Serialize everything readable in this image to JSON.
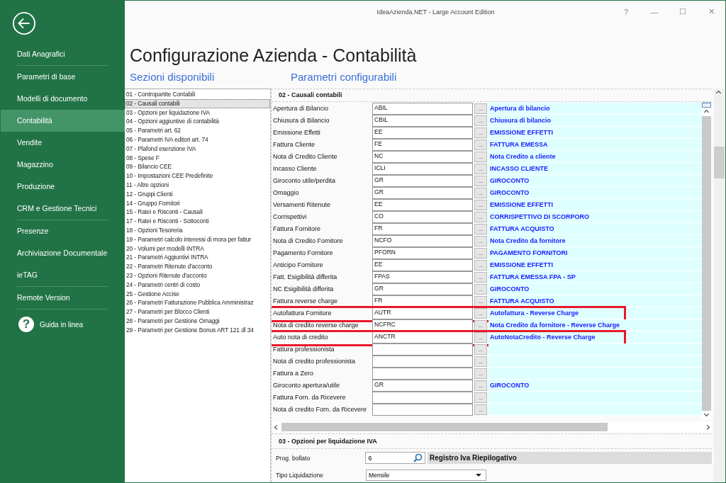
{
  "window": {
    "title": "IdeaAzienda.NET - Large Account Edition",
    "controls": [
      "?",
      "—",
      "☐",
      "✕"
    ]
  },
  "sidebar": {
    "items": [
      {
        "label": "Dati Anagrafici",
        "selected": false,
        "separator": true
      },
      {
        "label": "Parametri di base",
        "selected": false,
        "separator": false
      },
      {
        "label": "Modelli di documento",
        "selected": false,
        "separator": false
      },
      {
        "label": "Contabilità",
        "selected": true,
        "separator": false
      },
      {
        "label": "Vendite",
        "selected": false,
        "separator": false
      },
      {
        "label": "Magazzino",
        "selected": false,
        "separator": false
      },
      {
        "label": "Produzione",
        "selected": false,
        "separator": false
      },
      {
        "label": "CRM e Gestione Tecnici",
        "selected": false,
        "separator": true
      },
      {
        "label": "Presenze",
        "selected": false,
        "separator": false
      },
      {
        "label": "Archiviazione Documentale",
        "selected": false,
        "separator": false
      },
      {
        "label": "ieTAG",
        "selected": false,
        "separator": true
      },
      {
        "label": "Remote Version",
        "selected": false,
        "separator": true
      }
    ],
    "help": {
      "icon": "?",
      "label": "Guida in linea"
    }
  },
  "page": {
    "title": "Configurazione Azienda - Contabilità",
    "sections_heading": "Sezioni disponibili",
    "params_heading": "Parametri configurabili"
  },
  "sections": [
    {
      "label": "01 - Contropartite Contabili",
      "selected": false
    },
    {
      "label": "02 - Causali contabili",
      "selected": true
    },
    {
      "label": "03 - Opzioni per liquidazione IVA",
      "selected": false
    },
    {
      "label": "04 - Opzioni aggiuntive di contabilità",
      "selected": false
    },
    {
      "label": "05 - Parametri art. 62",
      "selected": false
    },
    {
      "label": "06 - Parametri IVA editori art. 74",
      "selected": false
    },
    {
      "label": "07 - Plafond esenzione IVA",
      "selected": false
    },
    {
      "label": "08 - Spese F",
      "selected": false
    },
    {
      "label": "09 - Bilancio CEE",
      "selected": false
    },
    {
      "label": "10 - Impostazioni CEE Predefinite",
      "selected": false
    },
    {
      "label": "11 - Altre opzioni",
      "selected": false
    },
    {
      "label": "12 - Gruppi Clienti",
      "selected": false
    },
    {
      "label": "14 - Gruppo Fornitori",
      "selected": false
    },
    {
      "label": "15 - Ratei e Risconti - Causali",
      "selected": false
    },
    {
      "label": "17 - Ratei e Risconti - Sottoconti",
      "selected": false
    },
    {
      "label": "18 - Opzioni Tesoreria",
      "selected": false
    },
    {
      "label": "19 - Parametri calcolo interessi di mora per fattur",
      "selected": false
    },
    {
      "label": "20 - Volumi per modelli INTRA",
      "selected": false
    },
    {
      "label": "21 - Parametri Aggiuntivi INTRA",
      "selected": false
    },
    {
      "label": "22 - Parametri Ritenute d'acconto",
      "selected": false
    },
    {
      "label": "23 - Opzioni Ritenute d'acconto",
      "selected": false
    },
    {
      "label": "24 - Parametri centri di costo",
      "selected": false
    },
    {
      "label": "25 - Gestione Accise",
      "selected": false
    },
    {
      "label": "26 - Parametri Fatturazione Pubblica Amministraz",
      "selected": false
    },
    {
      "label": "27 - Parametri per Blocco Clienti",
      "selected": false
    },
    {
      "label": "28 - Parametri per Gestione Omaggi",
      "selected": false
    },
    {
      "label": "29 - Parametri per Gestione Bonus ART 121 dl 34",
      "selected": false
    }
  ],
  "causali": {
    "title": "02 - Causali contabili",
    "browse": "...",
    "rows": [
      {
        "label": "Apertura di Bilancio",
        "code": "ABIL",
        "description": "Apertura di bilancio",
        "highlighted": false
      },
      {
        "label": "Chiusura di Bilancio",
        "code": "CBIL",
        "description": "Chiusura di bilancio",
        "highlighted": false
      },
      {
        "label": "Emissione Effetti",
        "code": "EE",
        "description": "EMISSIONE EFFETTI",
        "highlighted": false
      },
      {
        "label": "Fattura Cliente",
        "code": "FE",
        "description": "FATTURA EMESSA",
        "highlighted": false
      },
      {
        "label": "Nota di Credito Cliente",
        "code": "NC",
        "description": "Nota Credito a cliente",
        "highlighted": false
      },
      {
        "label": "Incasso Cliente",
        "code": "ICLI",
        "description": "INCASSO CLIENTE",
        "highlighted": false
      },
      {
        "label": "Giroconto utile/perdita",
        "code": "GR",
        "description": "GIROCONTO",
        "highlighted": false
      },
      {
        "label": "Omaggio",
        "code": "GR",
        "description": "GIROCONTO",
        "highlighted": false
      },
      {
        "label": "Versamenti Ritenute",
        "code": "EE",
        "description": "EMISSIONE EFFETTI",
        "highlighted": false
      },
      {
        "label": "Corrispettivi",
        "code": "CO",
        "description": "CORRISPETTIVO DI SCORPORO",
        "highlighted": false
      },
      {
        "label": "Fattura Fornitore",
        "code": "FR",
        "description": "FATTURA ACQUISTO",
        "highlighted": false
      },
      {
        "label": "Nota di Credito Fornitore",
        "code": "NCFO",
        "description": "Nota Credito da fornitore",
        "highlighted": false
      },
      {
        "label": "Pagamento Fornitore",
        "code": "PFORN",
        "description": "PAGAMENTO FORNITORI",
        "highlighted": false
      },
      {
        "label": "Anticipo Fornitore",
        "code": "EE",
        "description": "EMISSIONE EFFETTI",
        "highlighted": false
      },
      {
        "label": "Fatt. Esigibilità differita",
        "code": "FPAS",
        "description": "FATTURA EMESSA FPA - SP",
        "highlighted": false
      },
      {
        "label": "NC Esigibilità differita",
        "code": "GR",
        "description": "GIROCONTO",
        "highlighted": false
      },
      {
        "label": "Fattura reverse charge",
        "code": "FR",
        "description": "FATTURA ACQUISTO",
        "highlighted": false
      },
      {
        "label": "Autofattura Fornitore",
        "code": "AUTR",
        "description": "Autofattura - Reverse Charge",
        "highlighted": true
      },
      {
        "label": "Nota di credito reverse charge",
        "code": "NCFRC",
        "description": "Nota Credito da fornitore - Reverse Charge",
        "highlighted": false
      },
      {
        "label": "Auto nota di credito",
        "code": "ANCTR",
        "description": "AutoNotaCredito - Reverse Charge",
        "highlighted": true
      },
      {
        "label": "Fattura professionista",
        "code": "",
        "description": "",
        "highlighted": false
      },
      {
        "label": "Nota di credito professionista",
        "code": "",
        "description": "",
        "highlighted": false
      },
      {
        "label": "Fattura a Zero",
        "code": "",
        "description": "",
        "highlighted": false
      },
      {
        "label": "Giroconto apertura/utile",
        "code": "GR",
        "description": "GIROCONTO",
        "highlighted": false
      },
      {
        "label": "Fattura Forn. da Ricevere",
        "code": "",
        "description": "",
        "highlighted": false
      },
      {
        "label": "Nota di credito Forn. da Ricevere",
        "code": "",
        "description": "",
        "highlighted": false
      }
    ]
  },
  "liquidazione": {
    "title": "03 - Opzioni per liquidazione IVA",
    "prog_bollato": {
      "label": "Prog. bollato",
      "value": "6",
      "description": "Registro Iva Riepilogativo"
    },
    "tipo": {
      "label": "Tipo Liquidazione",
      "value": "Mensile"
    }
  }
}
